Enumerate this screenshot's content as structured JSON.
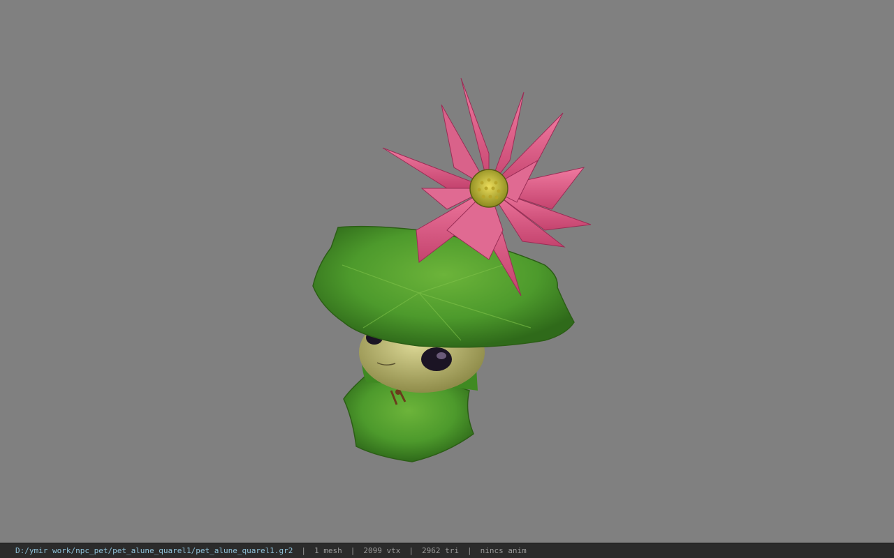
{
  "viewport": {
    "background_color": "#808080",
    "model": {
      "description_icon": "lotus-leaf-pet-model",
      "colors": {
        "petal": "#e0577f",
        "petal_dark": "#b83a64",
        "leaf": "#4d9a2c",
        "leaf_dark": "#2f6a1a",
        "face": "#c8c47a",
        "center": "#d8c43a"
      }
    }
  },
  "statusbar": {
    "file_path": "D:/ymir work/npc_pet/pet_alune_quarel1/pet_alune_quarel1.gr2",
    "separator": "|",
    "mesh": "1 mesh",
    "vertices": "2099 vtx",
    "triangles": "2962 tri",
    "animation": "nincs anim",
    "path_color": "#8fc1d8",
    "text_color": "#9a9a9a",
    "background_color": "#2b2b2b"
  }
}
